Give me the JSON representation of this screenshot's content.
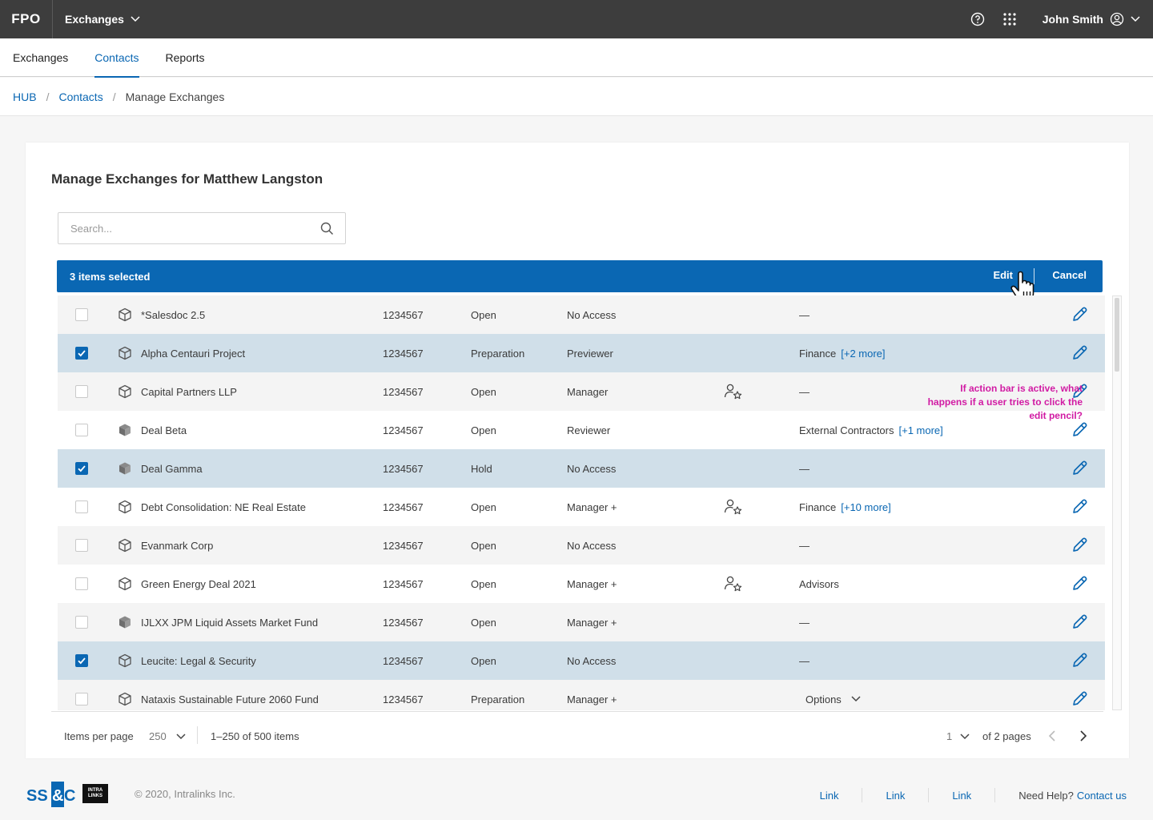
{
  "topbar": {
    "logo": "FPO",
    "app_name": "Exchanges",
    "user_name": "John Smith"
  },
  "subnav": {
    "tabs": [
      {
        "label": "Exchanges",
        "active": false
      },
      {
        "label": "Contacts",
        "active": true
      },
      {
        "label": "Reports",
        "active": false
      }
    ]
  },
  "breadcrumb": {
    "hub": "HUB",
    "contacts": "Contacts",
    "current": "Manage Exchanges"
  },
  "page": {
    "title": "Manage Exchanges for Matthew Langston",
    "search_placeholder": "Search..."
  },
  "action_bar": {
    "selected_text": "3 items selected",
    "edit_label": "Edit",
    "cancel_label": "Cancel"
  },
  "rows": [
    {
      "name": "*Salesdoc 2.5",
      "id": "1234567",
      "status": "Open",
      "role": "No Access",
      "group": "—",
      "more": "",
      "checked": false,
      "icon": "cube-outline-icon",
      "user_icon": false
    },
    {
      "name": "Alpha Centauri Project",
      "id": "1234567",
      "status": "Preparation",
      "role": "Previewer",
      "group": "Finance",
      "more": "[+2 more]",
      "checked": true,
      "icon": "cube-outline-icon",
      "user_icon": false
    },
    {
      "name": "Capital Partners LLP",
      "id": "1234567",
      "status": "Open",
      "role": "Manager",
      "group": "—",
      "more": "",
      "checked": false,
      "icon": "cube-outline-icon",
      "user_icon": true
    },
    {
      "name": "Deal Beta",
      "id": "1234567",
      "status": "Open",
      "role": "Reviewer",
      "group": "External Contractors",
      "more": "[+1 more]",
      "checked": false,
      "icon": "cube-filled-icon",
      "user_icon": false
    },
    {
      "name": "Deal Gamma",
      "id": "1234567",
      "status": "Hold",
      "role": "No Access",
      "group": "—",
      "more": "",
      "checked": true,
      "icon": "cube-filled-icon",
      "user_icon": false
    },
    {
      "name": "Debt Consolidation: NE Real Estate",
      "id": "1234567",
      "status": "Open",
      "role": "Manager +",
      "group": "Finance",
      "more": "[+10 more]",
      "checked": false,
      "icon": "cube-outline-icon",
      "user_icon": true
    },
    {
      "name": "Evanmark Corp",
      "id": "1234567",
      "status": "Open",
      "role": "No Access",
      "group": "—",
      "more": "",
      "checked": false,
      "icon": "cube-outline-icon",
      "user_icon": false
    },
    {
      "name": "Green Energy Deal 2021",
      "id": "1234567",
      "status": "Open",
      "role": "Manager +",
      "group": "Advisors",
      "more": "",
      "checked": false,
      "icon": "cube-outline-icon",
      "user_icon": true
    },
    {
      "name": "IJLXX JPM Liquid Assets Market Fund",
      "id": "1234567",
      "status": "Open",
      "role": "Manager +",
      "group": "—",
      "more": "",
      "checked": false,
      "icon": "cube-filled-icon",
      "user_icon": false
    },
    {
      "name": "Leucite: Legal & Security",
      "id": "1234567",
      "status": "Open",
      "role": "No Access",
      "group": "—",
      "more": "",
      "checked": true,
      "icon": "cube-outline-icon",
      "user_icon": false
    },
    {
      "name": "Nataxis Sustainable Future 2060 Fund",
      "id": "1234567",
      "status": "Preparation",
      "role": "Manager +",
      "group": "",
      "options": "Options",
      "more": "",
      "checked": false,
      "icon": "cube-outline-icon",
      "user_icon": false
    }
  ],
  "annotation": "If action bar is active, what happens if a user tries to click the edit pencil?",
  "pagination": {
    "items_per_page_label": "Items per page",
    "items_per_page_value": "250",
    "range_text": "1–250 of 500 items",
    "page_value": "1",
    "of_pages": "of 2 pages"
  },
  "footer": {
    "brand": "SS&C",
    "brand_partner": "INTRA LINKS",
    "copyright": "© 2020, Intralinks Inc.",
    "links": [
      "Link",
      "Link",
      "Link"
    ],
    "help_text": "Need Help?",
    "contact_label": "Contact us"
  },
  "colors": {
    "accent": "#0a67b3",
    "topbar": "#3d3d3d",
    "selected_row": "#d0dfe9",
    "annotation": "#d11aa3"
  }
}
